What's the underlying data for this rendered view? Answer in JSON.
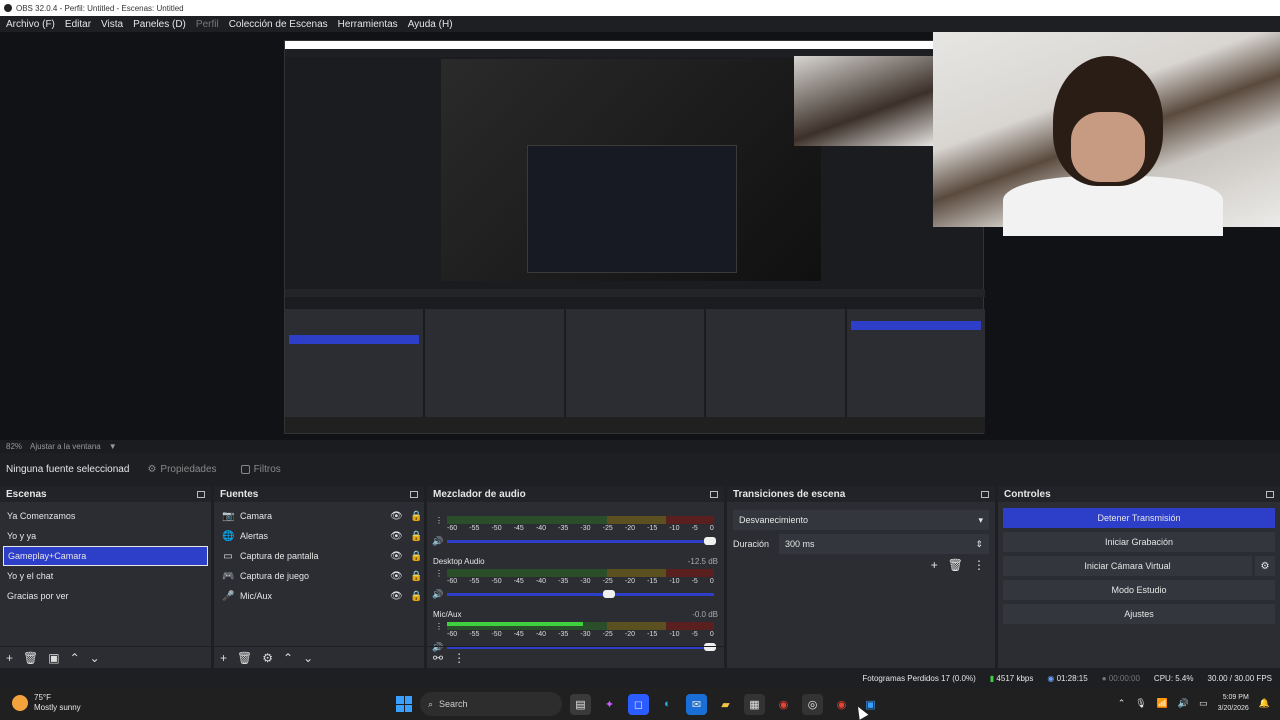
{
  "window": {
    "title": "OBS 32.0.4 - Perfil: Untitled - Escenas: Untitled"
  },
  "menu": [
    {
      "label": "Archivo (F)",
      "enabled": true
    },
    {
      "label": "Editar",
      "enabled": true
    },
    {
      "label": "Vista",
      "enabled": true
    },
    {
      "label": "Paneles (D)",
      "enabled": true
    },
    {
      "label": "Perfil",
      "enabled": false
    },
    {
      "label": "Colección de Escenas",
      "enabled": true
    },
    {
      "label": "Herramientas",
      "enabled": true
    },
    {
      "label": "Ayuda (H)",
      "enabled": true
    }
  ],
  "zoom": {
    "value": "82%",
    "fit_label": "Ajustar a la ventana"
  },
  "source_toolbar": {
    "selection": "Ninguna fuente seleccionad",
    "properties": "Propiedades",
    "filters": "Filtros"
  },
  "scenes": {
    "title": "Escenas",
    "items": [
      "Ya Comenzamos",
      "Yo y ya",
      "Gameplay+Camara",
      "Yo y el chat",
      "Gracias por ver"
    ],
    "selected_index": 2
  },
  "sources": {
    "title": "Fuentes",
    "items": [
      {
        "name": "Camara",
        "icon": "camera-icon"
      },
      {
        "name": "Alertas",
        "icon": "globe-icon"
      },
      {
        "name": "Captura de pantalla",
        "icon": "monitor-icon"
      },
      {
        "name": "Captura de juego",
        "icon": "gamepad-icon"
      },
      {
        "name": "Mic/Aux",
        "icon": "microphone-icon"
      }
    ]
  },
  "mixer": {
    "title": "Mezclador de audio",
    "ticks": [
      "-60",
      "-55",
      "-50",
      "-45",
      "-40",
      "-35",
      "-30",
      "-25",
      "-20",
      "-15",
      "-10",
      "-5",
      "0"
    ],
    "channels": [
      {
        "name": "",
        "db": "",
        "level": 0.0,
        "volume": 1.0
      },
      {
        "name": "Desktop Audio",
        "db": "-12.5 dB",
        "level": 0.0,
        "volume": 0.62
      },
      {
        "name": "Mic/Aux",
        "db": "-0.0 dB",
        "level": 0.51,
        "volume": 1.0
      }
    ]
  },
  "transitions": {
    "title": "Transiciones de escena",
    "type": "Desvanecimiento",
    "duration_label": "Duración",
    "duration": "300 ms"
  },
  "controls": {
    "title": "Controles",
    "stop_stream": "Detener Transmisión",
    "start_record": "Iniciar Grabación",
    "virtual_cam": "Iniciar Cámara Virtual",
    "studio_mode": "Modo Estudio",
    "settings": "Ajustes"
  },
  "status": {
    "dropped": "Fotogramas Perdidos 17 (0.0%)",
    "bitrate": "4517 kbps",
    "stream_time": "01:28:15",
    "rec_time": "00:00:00",
    "cpu": "CPU: 5.4%",
    "fps": "30.00 / 30.00 FPS"
  },
  "taskbar": {
    "weather_temp": "75°F",
    "weather_desc": "Mostly sunny",
    "search_placeholder": "Search",
    "time": "5:09 PM",
    "date": "3/20/2026"
  },
  "colors": {
    "accent": "#2d3ec8",
    "panel": "#2b2d33",
    "background": "#1e1f23",
    "meter_green": "#3fcf3f"
  }
}
